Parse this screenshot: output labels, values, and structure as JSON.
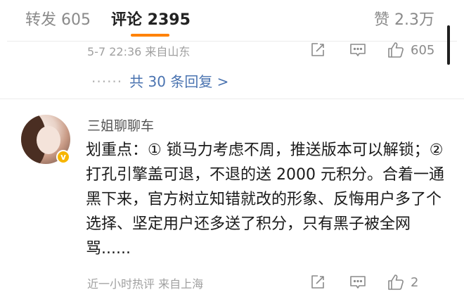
{
  "tabs": {
    "forward": "转发 605",
    "comments": "评论 2395",
    "likes": "赞 2.3万"
  },
  "colors": {
    "accent": "#ff8200",
    "link": "#4a73b0",
    "verified": "#f7b500"
  },
  "previous_comment": {
    "meta": "5-7 22:36  来自山东",
    "like_count": "605",
    "replies_link": "共 30 条回复 >"
  },
  "comment": {
    "username": "三姐聊聊车",
    "badge": "v",
    "text": "划重点：① 锁马力考虑不周，推送版本可以解锁；② 打孔引擎盖可退，不退的送 2000 元积分。合着一通黑下来，官方树立知错就改的形象、反悔用户多了个选择、坚定用户还多送了积分，只有黑子被全网骂......",
    "meta": "近一小时热评  来自上海",
    "like_count": "2"
  },
  "icons": {
    "share": "share-icon",
    "comment": "comment-icon",
    "like": "thumbs-up-icon"
  }
}
